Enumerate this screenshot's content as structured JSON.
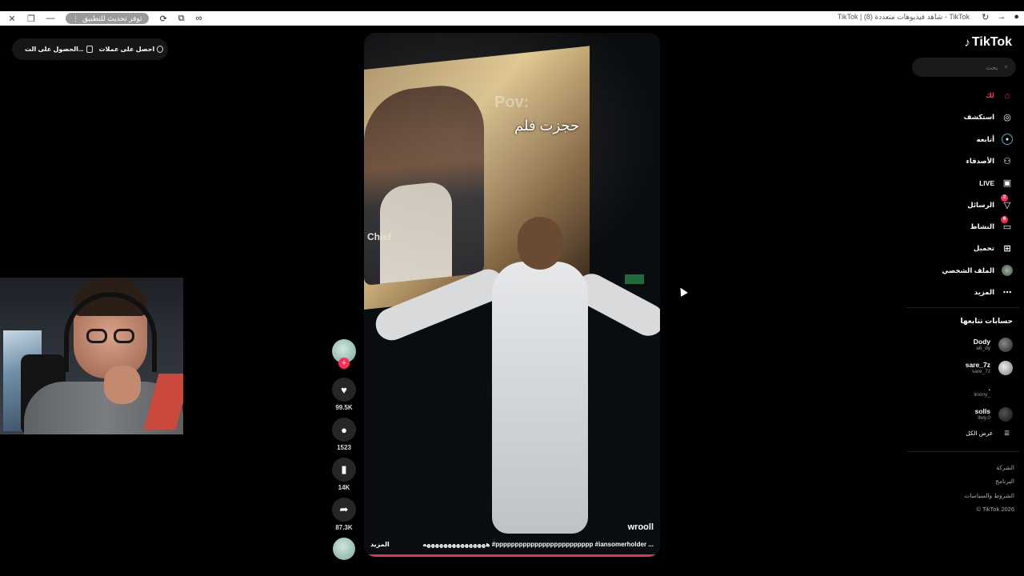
{
  "chrome": {
    "update_label": "توفر تحديث للتطبيق",
    "tab_title": "TikTok | شاهد فيديوهات متعددة (8) - TikTok",
    "icons": [
      "close-icon",
      "restore-icon",
      "minimize-icon",
      "menu-dots-icon",
      "extension-icon",
      "share-icon",
      "glasses-icon",
      "reload-icon",
      "forward-icon",
      "app-icon"
    ]
  },
  "promo": {
    "ads_label": "احصل على عملات",
    "app_label": "الحصول على الت..."
  },
  "video": {
    "overlay_text_pov": "Pov:",
    "overlay_caption": "حجزت فلم",
    "watermark": "Chief",
    "author": "wrooll",
    "description": "هههههههههههههههه #ppppppppppppppppppppppppp #iansomerholder ...",
    "more_label": "المزيد",
    "progress": 0.99
  },
  "rail": {
    "likes": "99.5K",
    "comments": "1523",
    "saves": "14K",
    "shares": "87.3K",
    "follow_plus": "+"
  },
  "sidebar": {
    "logo": "TikTok",
    "search_placeholder": "بحث",
    "nav": [
      {
        "label": "لك",
        "icon": "home-icon"
      },
      {
        "label": "استكشف",
        "icon": "compass-icon"
      },
      {
        "label": "أتابعه",
        "icon": "following-icon"
      },
      {
        "label": "الأصدقاء",
        "icon": "friends-icon"
      },
      {
        "label": "LIVE",
        "icon": "live-icon"
      },
      {
        "label": "الرسائل",
        "icon": "messages-icon",
        "badge": "2"
      },
      {
        "label": "النشاط",
        "icon": "activity-icon",
        "badge": "6"
      },
      {
        "label": "تحميل",
        "icon": "upload-icon"
      },
      {
        "label": "الملف الشخصي",
        "icon": "profile-icon"
      },
      {
        "label": "المزيد",
        "icon": "more-icon"
      }
    ],
    "following_title": "حسابات تتابعها",
    "accounts": [
      {
        "name": "Dody",
        "handle": "a6_dy"
      },
      {
        "name": "sare_7z",
        "handle": "sare_7z"
      },
      {
        "name": ".",
        "handle": "linony_"
      },
      {
        "name": "solls",
        "handle": "llwy.0"
      }
    ],
    "see_all": "عرض الكل",
    "footer": [
      "الشركة",
      "البرنامج",
      "الشروط والسياسات",
      "© TikTok 2026"
    ]
  },
  "colors": {
    "accent": "#fe2c55",
    "background": "#000000"
  }
}
